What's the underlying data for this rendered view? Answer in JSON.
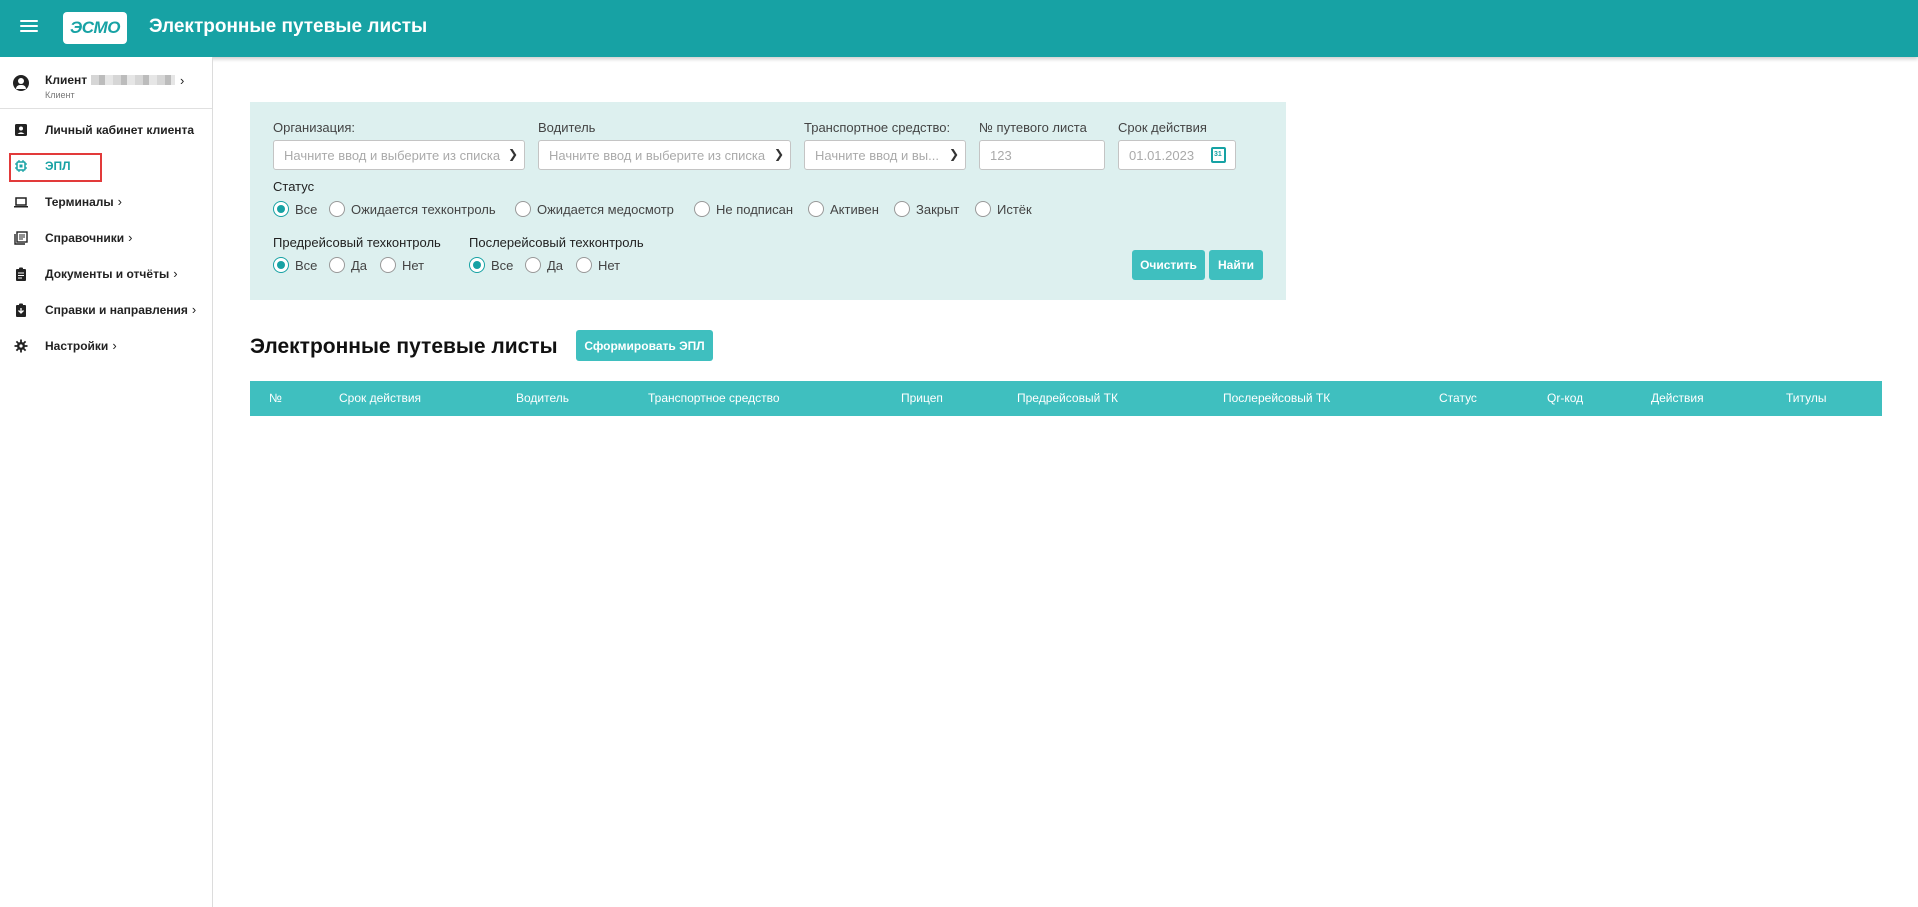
{
  "header": {
    "logo_text": "ЭСМО",
    "title": "Электронные путевые листы"
  },
  "sidebar": {
    "client": {
      "name": "Клиент",
      "sub": "Клиент",
      "chevron": "›"
    },
    "items": [
      {
        "label": "Личный кабинет клиента",
        "icon": "contact-card-icon",
        "chevron": ""
      },
      {
        "label": "ЭПЛ",
        "icon": "chip-icon",
        "chevron": ""
      },
      {
        "label": "Терминалы",
        "icon": "laptop-icon",
        "chevron": "›"
      },
      {
        "label": "Справочники",
        "icon": "library-icon",
        "chevron": "›"
      },
      {
        "label": "Документы и отчёты",
        "icon": "clipboard-icon",
        "chevron": "›"
      },
      {
        "label": "Справки и направления",
        "icon": "clipboard-download-icon",
        "chevron": "›"
      },
      {
        "label": "Настройки",
        "icon": "gear-icon",
        "chevron": "›"
      }
    ]
  },
  "filters": {
    "organization": {
      "label": "Организация:",
      "placeholder": "Начните ввод и выберите из списка"
    },
    "driver": {
      "label": "Водитель",
      "placeholder": "Начните ввод и выберите из списка"
    },
    "vehicle": {
      "label": "Транспортное средство:",
      "placeholder": "Начните ввод и вы..."
    },
    "waybill_number": {
      "label": "№ путевого листа",
      "placeholder": "123"
    },
    "validity": {
      "label": "Срок действия",
      "placeholder": "01.01.2023"
    },
    "status": {
      "label": "Статус",
      "options": [
        "Все",
        "Ожидается техконтроль",
        "Ожидается медосмотр",
        "Не подписан",
        "Активен",
        "Закрыт",
        "Истёк"
      ],
      "selected": "Все"
    },
    "pre_trip": {
      "label": "Предрейсовый техконтроль",
      "options": [
        "Все",
        "Да",
        "Нет"
      ],
      "selected": "Все"
    },
    "post_trip": {
      "label": "Послерейсовый техконтроль",
      "options": [
        "Все",
        "Да",
        "Нет"
      ],
      "selected": "Все"
    },
    "clear_label": "Очистить",
    "search_label": "Найти"
  },
  "main": {
    "title": "Электронные путевые листы",
    "create_label": "Сформировать ЭПЛ",
    "columns": [
      "№",
      "Срок действия",
      "Водитель",
      "Транспортное средство",
      "Прицеп",
      "Предрейсовый ТК",
      "Послерейсовый ТК",
      "Статус",
      "Qr-код",
      "Действия",
      "Титулы"
    ]
  },
  "colors": {
    "primary": "#17a2a4",
    "accent": "#3fbfbf",
    "panel": "#ddf0ef",
    "highlight": "#e23a3a"
  }
}
